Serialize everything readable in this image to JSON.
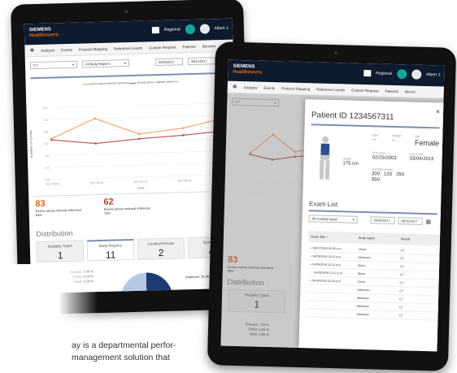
{
  "back_tablet": {
    "logo_line1": "SIEMENS",
    "logo_line2": "Healthineers",
    "header_label": "Regional",
    "user": "Albert J.",
    "nav": [
      "Analysis",
      "Events",
      "Protocol Mapping",
      "Reference Levels",
      "Custom Request",
      "Patients",
      "Benchm"
    ],
    "filter_modality": "CT",
    "filter_region": "All Body Regions",
    "date_from": "05/05/2017",
    "date_to": "06/11/2017",
    "legend_a": "Exams above internal reference",
    "legend_b": "Exams above national reference",
    "x_axis_label": "DATE",
    "y_axis_label": "NUMBER OF EXAMS",
    "kpi_a_value": "83",
    "kpi_a_label": "Exams above internal reference",
    "kpi_a_sub": "84%",
    "kpi_b_value": "62",
    "kpi_b_label": "Exams above national reference",
    "kpi_b_sub": "73%",
    "distribution_title": "Distribution",
    "dist": [
      {
        "label": "Modality Types",
        "value": "1"
      },
      {
        "label": "Body Regions",
        "value": "11"
      },
      {
        "label": "Location/Groups",
        "value": "2"
      },
      {
        "label": "Operators",
        "value": "4"
      }
    ],
    "pie_labels": [
      "Sinuses: 7.06 %",
      "Pelvis: 3.53 %",
      "Neck: 3.59 %"
    ],
    "pie_label_right": "Abdomen: 35.86 %"
  },
  "front_tablet": {
    "logo_line1": "SIEMENS",
    "logo_line2": "Healthineers",
    "header_label": "Regional",
    "user": "Albert J.",
    "nav": [
      "Analysis",
      "Events",
      "Protocol Mapping",
      "Reference Levels",
      "Custom Request",
      "Patients",
      "Bench"
    ],
    "filter_modality": "CT",
    "dist_title": "Distribution",
    "dist_box_label": "Modality Types",
    "dist_box_value": "1",
    "kpi_value": "83",
    "kpi_label": "Exams above internal reference",
    "kpi_sub": "98%",
    "pie_labels": [
      "Sinuses: 7.06 %",
      "Pelvis: 3.53 %",
      "Neck: 3.59 %"
    ],
    "modal": {
      "close": "×",
      "title": "Patient ID 1234567311",
      "age_label": "Age",
      "age_value": "--",
      "weight_label": "Weight",
      "weight_value": "--",
      "sex_label": "Sex",
      "sex_value": "Female",
      "height_label": "Height",
      "height_value": "175 cm",
      "first_exam_label": "First exam",
      "first_exam_value": "02/25/2003",
      "last_exam_label": "Last exam",
      "last_exam_value": "03/04/2016",
      "cum_dose_label": "Cumulative dose",
      "dose_a": "300",
      "dose_b": "120",
      "dose_c": "250",
      "dose_d": "550",
      "exam_list_title": "Exam List",
      "study_filter": "All modality types",
      "exam_date_from": "05/04/2017",
      "exam_date_to": "06/10/2017",
      "col_date": "Study date ↑",
      "col_region": "Body region",
      "col_modality": "Modali",
      "rows": [
        {
          "date": "+ 06/27/2016 02:35 p.m.",
          "region": "Chest",
          "mod": "CT"
        },
        {
          "date": "+ 04/28/2016 12:51 p.m.",
          "region": "Abdomen",
          "mod": "CT"
        },
        {
          "date": "+ 04/28/2016 12:12 p.m.",
          "region": "Spine",
          "mod": "CT"
        },
        {
          "date": "04/28/2016 12:12 p.m.",
          "region": "Spine",
          "mod": "CT"
        },
        {
          "date": "+ 04/28/2016 02:29 p.m.",
          "region": "Chest",
          "mod": "CT"
        },
        {
          "date": "",
          "region": "Abdomen",
          "mod": "CT"
        },
        {
          "date": "",
          "region": "Abdomen",
          "mod": "CT"
        },
        {
          "date": "",
          "region": "Abdomen",
          "mod": "CT"
        },
        {
          "date": "",
          "region": "Abdomen",
          "mod": "CT"
        }
      ]
    }
  },
  "page_text": {
    "line1": "ay is a departmental perfor-",
    "line2": "management solution that"
  },
  "chart_data": {
    "type": "line",
    "x": [
      "2017-05-05",
      "2017-05-12",
      "2017-05-19",
      "2017-05-26",
      "2017-06-02"
    ],
    "series": [
      {
        "name": "Exams above internal reference",
        "values": [
          3.4,
          5.0,
          3.6,
          4.0,
          4.8
        ]
      },
      {
        "name": "Exams above national reference",
        "values": [
          3.3,
          2.9,
          3.2,
          3.4,
          3.7
        ]
      }
    ],
    "ylim": [
      0,
      6
    ],
    "colors": [
      "#f0a060",
      "#c0504d"
    ]
  }
}
